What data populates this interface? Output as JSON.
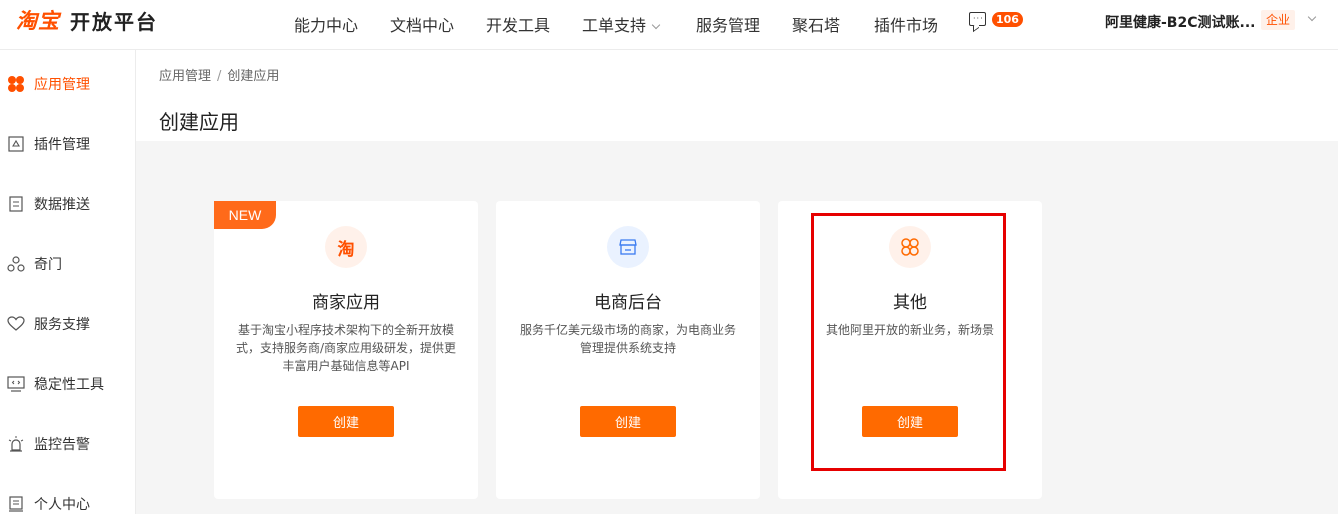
{
  "brand": {
    "logo_text": "淘宝",
    "platform": "开放平台"
  },
  "nav": {
    "items": [
      {
        "label": "能力中心"
      },
      {
        "label": "文档中心"
      },
      {
        "label": "开发工具"
      },
      {
        "label": "工单支持"
      },
      {
        "label": "服务管理"
      },
      {
        "label": "聚石塔"
      },
      {
        "label": "插件市场"
      }
    ],
    "message_count": "106",
    "account": "阿里健康-B2C测试账...",
    "account_type": "企业"
  },
  "sidebar": {
    "items": [
      {
        "label": "应用管理",
        "icon": "app-grid-icon",
        "active": true
      },
      {
        "label": "插件管理",
        "icon": "plugin-icon"
      },
      {
        "label": "数据推送",
        "icon": "data-push-icon"
      },
      {
        "label": "奇门",
        "icon": "qimen-icon"
      },
      {
        "label": "服务支撑",
        "icon": "heart-icon"
      },
      {
        "label": "稳定性工具",
        "icon": "code-monitor-icon"
      },
      {
        "label": "监控告警",
        "icon": "alarm-icon"
      },
      {
        "label": "个人中心",
        "icon": "profile-icon"
      }
    ]
  },
  "breadcrumb": {
    "parent": "应用管理",
    "separator": "/",
    "current": "创建应用"
  },
  "page": {
    "title": "创建应用"
  },
  "cards": [
    {
      "tag": "NEW",
      "icon_text": "淘",
      "icon": "taobao-icon",
      "title": "商家应用",
      "description": "基于淘宝小程序技术架构下的全新开放模式，支持服务商/商家应用级研发，提供更丰富用户基础信息等API",
      "button": "创建"
    },
    {
      "icon": "store-icon",
      "title": "电商后台",
      "description": "服务千亿美元级市场的商家，为电商业务管理提供系统支持",
      "button": "创建"
    },
    {
      "icon": "clover-icon",
      "title": "其他",
      "description": "其他阿里开放的新业务，新场景",
      "button": "创建"
    }
  ],
  "colors": {
    "accent": "#ff6a00",
    "highlight": "#e60000"
  }
}
